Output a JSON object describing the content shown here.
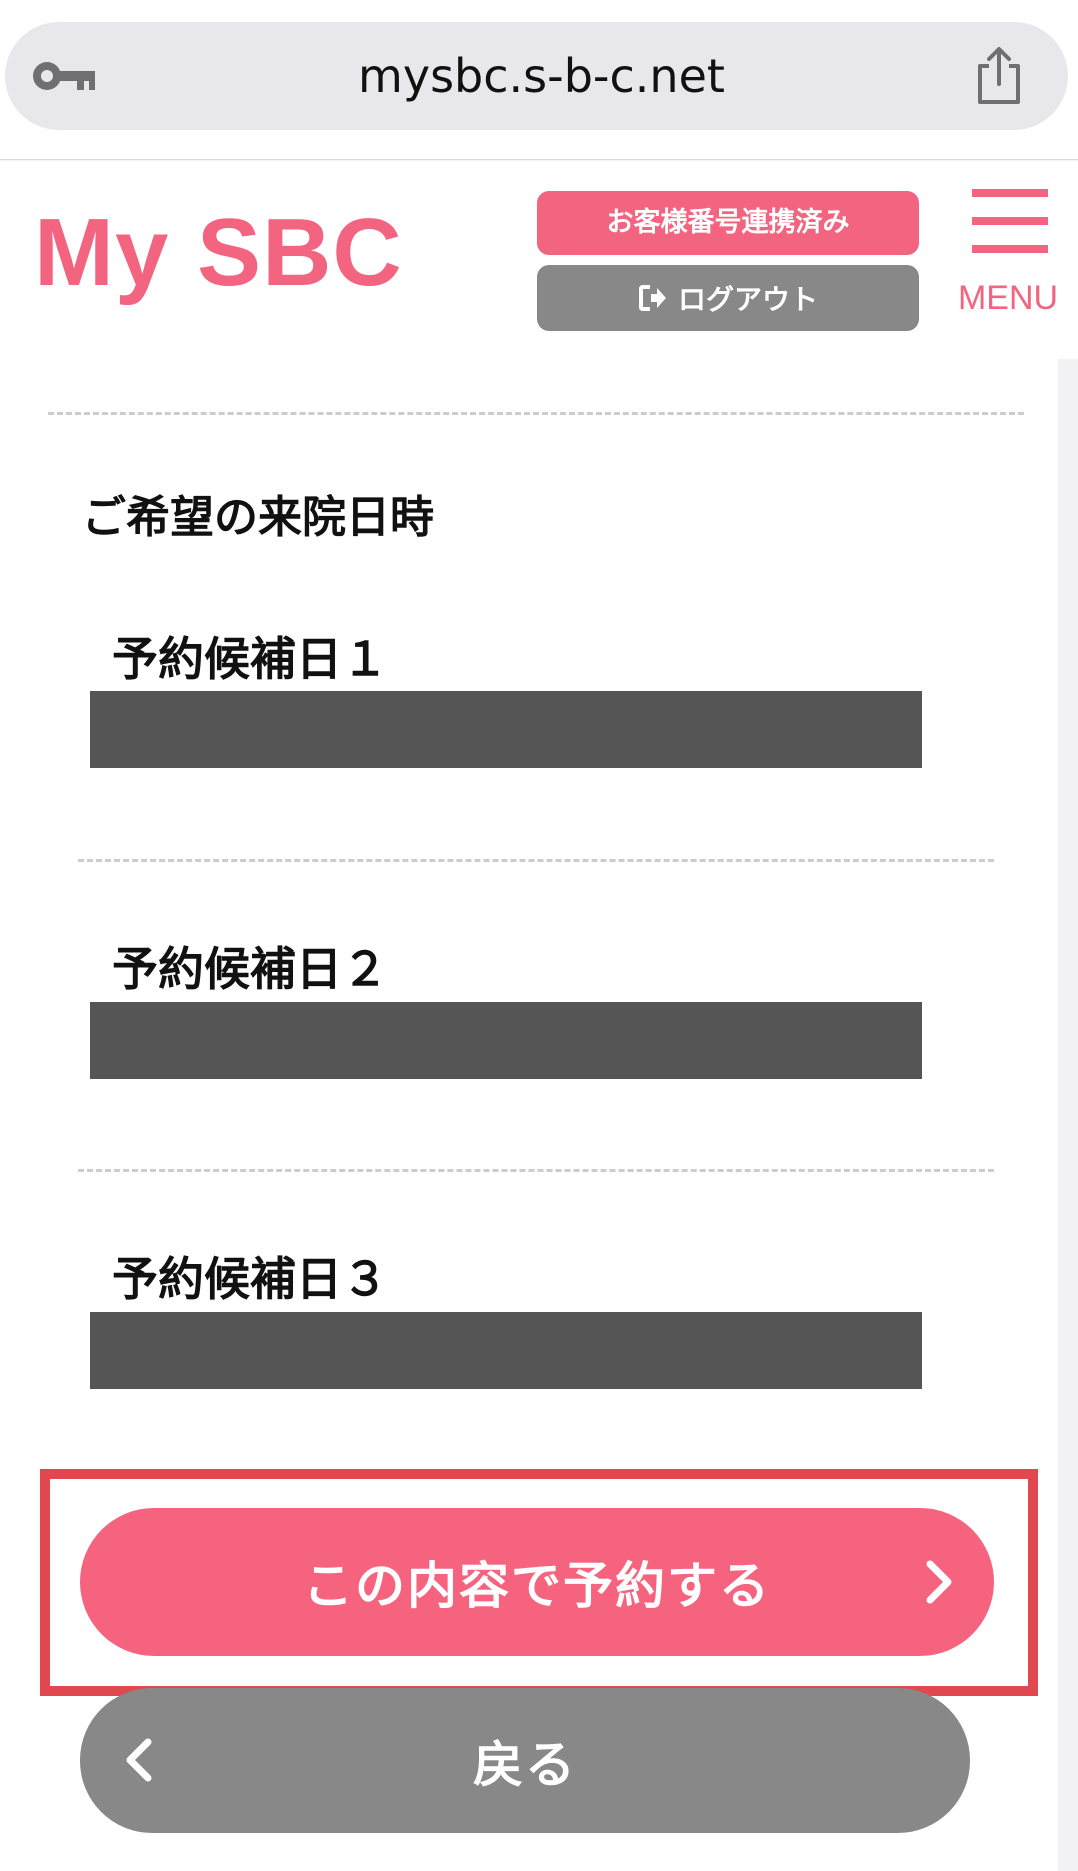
{
  "browser": {
    "url": "mysbc.s-b-c.net",
    "key_icon": "key-icon",
    "share_icon": "share-icon"
  },
  "header": {
    "logo": "My SBC",
    "link_badge": "お客様番号連携済み",
    "logout_label": "ログアウト",
    "menu_label": "MENU",
    "accent_color": "#f26480"
  },
  "form": {
    "section_title": "ご希望の来院日時",
    "candidates": [
      {
        "label": "予約候補日１",
        "value": ""
      },
      {
        "label": "予約候補日２",
        "value": ""
      },
      {
        "label": "予約候補日３",
        "value": ""
      }
    ]
  },
  "actions": {
    "confirm_label": "この内容で予約する",
    "back_label": "戻る"
  }
}
